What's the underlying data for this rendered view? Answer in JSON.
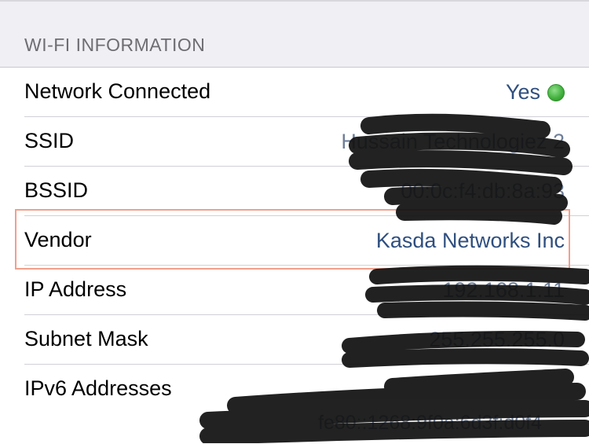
{
  "section": {
    "header": "WI-FI INFORMATION"
  },
  "rows": [
    {
      "label": "Network Connected",
      "value": "Yes"
    },
    {
      "label": "SSID",
      "value": "Hussain Technologiez 2"
    },
    {
      "label": "BSSID",
      "value": "00:0c:f4:db:8a:93"
    },
    {
      "label": "Vendor",
      "value": "Kasda Networks Inc"
    },
    {
      "label": "IP Address",
      "value": "192.168.1.11"
    },
    {
      "label": "Subnet Mask",
      "value": "255.255.255.0"
    },
    {
      "label": "IPv6 Addresses",
      "value": "fe80::1268:9f0a:6d3f:d0f4"
    }
  ],
  "colors": {
    "value_text": "#2f4f7f",
    "status_green": "#3fae3a",
    "highlight_border": "#f0a08c",
    "redaction": "#111111"
  },
  "icons": {
    "connected_status": "green-status-dot-icon"
  }
}
